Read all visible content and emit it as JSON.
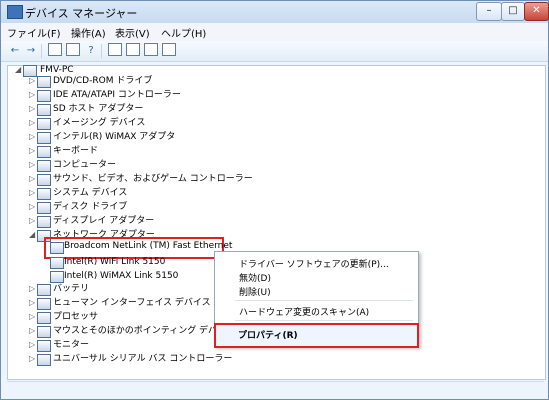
{
  "window": {
    "title": "デバイス マネージャー",
    "controls": {
      "minimize": "–",
      "maximize": "□",
      "close": "✕"
    }
  },
  "menu": [
    {
      "label": "ファイル(F)"
    },
    {
      "label": "操作(A)"
    },
    {
      "label": "表示(V)"
    },
    {
      "label": "ヘルプ(H)"
    }
  ],
  "toolbar": {
    "buttons": [
      {
        "icon": "back-arrow-icon",
        "glyph": "←"
      },
      {
        "icon": "forward-arrow-icon",
        "glyph": "→"
      },
      {
        "icon": "properties-icon",
        "glyph": ""
      },
      {
        "icon": "show-hide-icon",
        "glyph": ""
      },
      {
        "icon": "help-icon",
        "glyph": "?"
      },
      {
        "icon": "scan-hardware-icon",
        "glyph": ""
      },
      {
        "icon": "update-driver-icon",
        "glyph": ""
      },
      {
        "icon": "uninstall-icon",
        "glyph": ""
      },
      {
        "icon": "disable-icon",
        "glyph": ""
      }
    ]
  },
  "tree": {
    "root": "FMV-PC",
    "items": [
      {
        "label": "DVD/CD-ROM ドライブ",
        "icon": "dvd-icon",
        "expander": "▷"
      },
      {
        "label": "IDE ATA/ATAPI コントローラー",
        "icon": "ide-icon",
        "expander": "▷"
      },
      {
        "label": "SD ホスト アダプター",
        "icon": "sd-icon",
        "expander": "▷"
      },
      {
        "label": "イメージング デバイス",
        "icon": "camera-icon",
        "expander": "▷"
      },
      {
        "label": "インテル(R) WiMAX アダプタ",
        "icon": "wimax-icon",
        "expander": "▷"
      },
      {
        "label": "キーボード",
        "icon": "keyboard-icon",
        "expander": "▷"
      },
      {
        "label": "コンピューター",
        "icon": "computer-icon",
        "expander": "▷"
      },
      {
        "label": "サウンド、ビデオ、およびゲーム コントローラー",
        "icon": "sound-icon",
        "expander": "▷"
      },
      {
        "label": "システム デバイス",
        "icon": "system-icon",
        "expander": "▷"
      },
      {
        "label": "ディスク ドライブ",
        "icon": "disk-icon",
        "expander": "▷"
      },
      {
        "label": "ディスプレイ アダプター",
        "icon": "display-icon",
        "expander": "▷"
      },
      {
        "label": "ネットワーク アダプター",
        "icon": "network-icon",
        "expander": "◢"
      }
    ],
    "network_children": [
      {
        "label": "Broadcom NetLink (TM) Fast Ethernet",
        "icon": "ethernet-icon"
      },
      {
        "label": "Intel(R) WiFi Link 5150",
        "icon": "wifi-icon"
      },
      {
        "label": "Intel(R) WiMAX Link 5150",
        "icon": "wimax-icon"
      }
    ],
    "items_after": [
      {
        "label": "バッテリ",
        "icon": "battery-icon",
        "expander": "▷"
      },
      {
        "label": "ヒューマン インターフェイス デバイス",
        "icon": "hid-icon",
        "expander": "▷"
      },
      {
        "label": "プロセッサ",
        "icon": "processor-icon",
        "expander": "▷"
      },
      {
        "label": "マウスとそのほかのポインティング デバイ",
        "icon": "mouse-icon",
        "expander": "▷"
      },
      {
        "label": "モニター",
        "icon": "monitor-icon",
        "expander": "▷"
      },
      {
        "label": "ユニバーサル シリアル バス コントローラー",
        "icon": "usb-icon",
        "expander": "▷"
      }
    ]
  },
  "context_menu": {
    "items": [
      {
        "label": "ドライバー ソフトウェアの更新(P)..."
      },
      {
        "label": "無効(D)"
      },
      {
        "label": "削除(U)"
      },
      {
        "label": "ハードウェア変更のスキャン(A)"
      },
      {
        "label": "プロパティ(R)"
      }
    ]
  },
  "colors": {
    "highlight": "#e02020",
    "window_border": "#6b8fb8",
    "title_bg": "#c8dbf1"
  }
}
